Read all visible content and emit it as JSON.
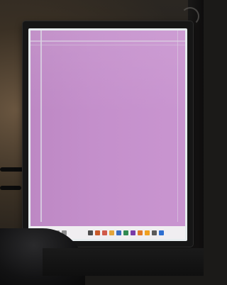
{
  "scene": {
    "screen_color": "#c48fcb",
    "bezel_color": "#161616",
    "taskbar_color": "#f0eef1"
  },
  "taskbar": {
    "icons": [
      {
        "name": "start-icon",
        "color": "#2c2c2c"
      },
      {
        "name": "search-icon",
        "color": "#8c8c8c"
      },
      {
        "name": "task-view-icon",
        "color": "#8c8c8c"
      },
      {
        "name": "widgets-icon",
        "color": "#8c8c8c"
      },
      {
        "name": "chat-icon",
        "color": "#8c8c8c"
      },
      {
        "name": "app-icon",
        "color": "#4d4d4d"
      },
      {
        "name": "app-icon",
        "color": "#c85a2a"
      },
      {
        "name": "app-icon",
        "color": "#d05a4a"
      },
      {
        "name": "app-icon",
        "color": "#e4a53a"
      },
      {
        "name": "app-icon",
        "color": "#3a6bbf"
      },
      {
        "name": "app-icon",
        "color": "#2f8a52"
      },
      {
        "name": "app-icon",
        "color": "#7a3ca8"
      },
      {
        "name": "app-icon",
        "color": "#e07a2a"
      },
      {
        "name": "app-icon",
        "color": "#f0a020"
      },
      {
        "name": "app-icon",
        "color": "#5a5a5a"
      },
      {
        "name": "app-icon",
        "color": "#2d6fd1"
      }
    ]
  }
}
